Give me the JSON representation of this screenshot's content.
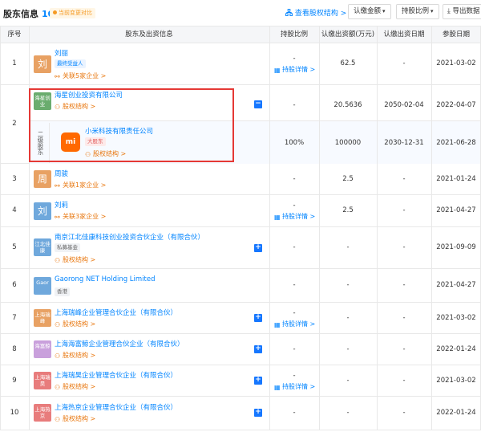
{
  "header": {
    "title": "股东信息",
    "count": "10",
    "badge": "当前变更对比",
    "link": "查看股权结构 >",
    "buttons": [
      "认缴金额",
      "持股比例",
      "导出数据"
    ]
  },
  "columns": [
    "序号",
    "股东及出资信息",
    "持股比例",
    "认缴出资额(万元)",
    "认缴出资日期",
    "参股日期"
  ],
  "rows": [
    {
      "idx": "1",
      "logo": "刘",
      "logo_color": "#e8a163",
      "name": "刘丽",
      "tag": "最终受益人",
      "tag_style": "blue",
      "sub": "关联5家企业 >",
      "ratio": "-",
      "ratio_link": "持股详情 >",
      "amount": "62.5",
      "date": "-",
      "join": "2021-03-02"
    },
    {
      "idx": "2",
      "logo": "海星创业",
      "logo_color": "#6aac6e",
      "name": "海星创业投资有限公司",
      "sub": "股权结构 >",
      "ratio": "-",
      "amount": "20.5636",
      "date": "2050-02-04",
      "join": "2022-04-07",
      "child": {
        "level": "二级股东",
        "name": "小米科技有限责任公司",
        "tag": "大股东",
        "ratio": "100%",
        "amount": "100000",
        "date": "2030-12-31",
        "join": "2021-06-28",
        "sub": "股权结构 >",
        "logo_text": "mi",
        "logo_color": "#ff6900"
      }
    },
    {
      "idx": "3",
      "logo": "周",
      "logo_color": "#e8a163",
      "name": "周骏",
      "sub": "关联1家企业 >",
      "ratio": "-",
      "amount": "2.5",
      "date": "-",
      "join": "2021-01-24"
    },
    {
      "idx": "4",
      "logo": "刘",
      "logo_color": "#6fa8dc",
      "name": "刘莉",
      "sub": "关联3家企业 >",
      "ratio": "-",
      "ratio_link": "持股详情 >",
      "amount": "2.5",
      "date": "-",
      "join": "2021-04-27"
    },
    {
      "idx": "5",
      "logo": "江北佳康",
      "logo_color": "#6fa8dc",
      "name": "南京江北佳康科技创业投资合伙企业（有限合伙）",
      "tag": "私募基金",
      "tag_style": "gray",
      "sub": "股权结构 >",
      "ratio": "-",
      "amount": "-",
      "date": "-",
      "join": "2021-09-09"
    },
    {
      "idx": "6",
      "logo": "Gaor",
      "logo_color": "#6fa8dc",
      "name": "Gaorong NET Holding Limited",
      "tag": "香港",
      "tag_style": "gray",
      "ratio": "-",
      "amount": "-",
      "date": "-",
      "join": "2021-04-27"
    },
    {
      "idx": "7",
      "logo": "上海瑞峰",
      "logo_color": "#e8a163",
      "name": "上海瑞峰企业管理合伙企业（有限合伙）",
      "sub": "股权结构 >",
      "ratio": "-",
      "ratio_link": "持股详情 >",
      "amount": "-",
      "date": "-",
      "join": "2021-03-02"
    },
    {
      "idx": "8",
      "logo": "海富鲸",
      "logo_color": "#c9a0dc",
      "name": "上海海富鲸企业管理合伙企业（有限合伙）",
      "sub": "股权结构 >",
      "ratio": "-",
      "amount": "-",
      "date": "-",
      "join": "2022-01-24"
    },
    {
      "idx": "9",
      "logo": "上海瑞昊",
      "logo_color": "#e87c7c",
      "name": "上海瑞昊企业管理合伙企业（有限合伙）",
      "sub": "股权结构 >",
      "ratio": "-",
      "ratio_link": "持股详情 >",
      "amount": "-",
      "date": "-",
      "join": "2021-03-02"
    },
    {
      "idx": "10",
      "logo": "上海热京",
      "logo_color": "#e87c7c",
      "name": "上海热京企业管理合伙企业（有限合伙）",
      "sub": "股权结构 >",
      "ratio": "-",
      "amount": "-",
      "date": "-",
      "join": "2022-01-24"
    }
  ]
}
